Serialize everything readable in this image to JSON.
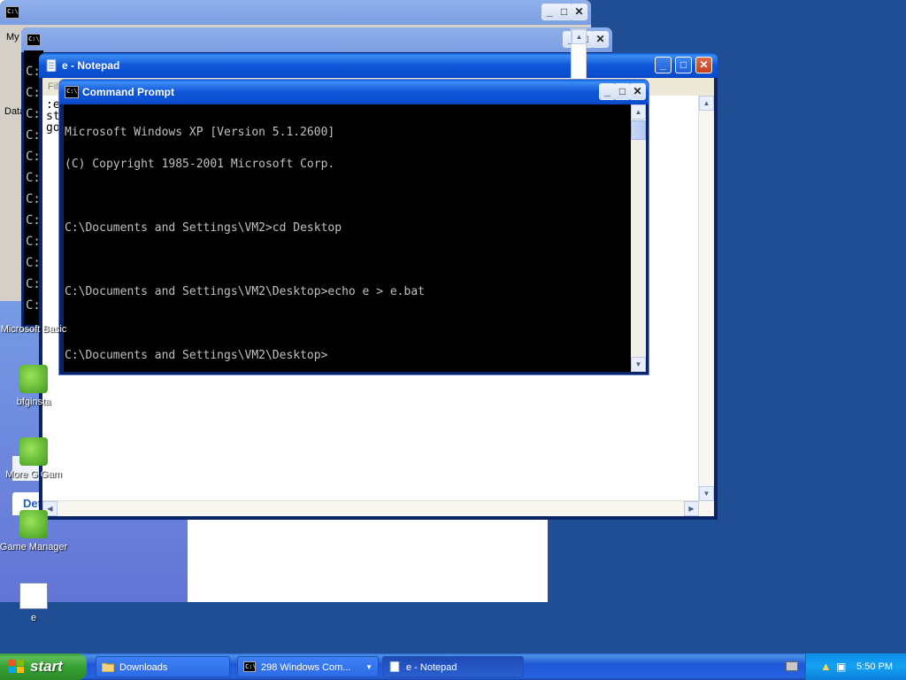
{
  "windows": {
    "back1": {
      "title": "",
      "side_text": [
        "My",
        "Data"
      ]
    },
    "back2": {
      "title": "",
      "prompts": [
        "C:",
        "C:",
        "C:",
        "C:",
        "C:",
        "C:",
        "C:",
        "C:",
        "C:",
        "C:",
        "C:",
        "C:"
      ]
    },
    "notepad": {
      "title": "e - Notepad",
      "menu_fragment": "File",
      "lines": [
        ":e",
        "st",
        "go"
      ]
    },
    "cmd": {
      "title": "Command Prompt",
      "lines": [
        "Microsoft Windows XP [Version 5.1.2600]",
        "(C) Copyright 1985-2001 Microsoft Corp.",
        "",
        "C:\\Documents and Settings\\VM2>cd Desktop",
        "",
        "C:\\Documents and Settings\\VM2\\Desktop>echo e > e.bat",
        "",
        "C:\\Documents and Settings\\VM2\\Desktop>"
      ]
    }
  },
  "explorer": {
    "details_label": "Details"
  },
  "desktop_icons": [
    {
      "label": "Microsoft Basic",
      "icon": "app-icon"
    },
    {
      "label": "bfginsta",
      "icon": "bfg-installer-icon"
    },
    {
      "label": "More G Gam",
      "icon": "bfg-shortcut-icon"
    },
    {
      "label": "Game Manager",
      "icon": "game-manager-icon"
    },
    {
      "label": "e",
      "icon": "batch-file-icon"
    }
  ],
  "taskbar": {
    "start_label": "start",
    "tasks": [
      {
        "label": "Downloads",
        "icon": "folder-icon"
      },
      {
        "label": "298 Windows Com...",
        "icon": "cmd-icon"
      },
      {
        "label": "e - Notepad",
        "icon": "notepad-icon"
      }
    ],
    "clock": "5:50 PM"
  },
  "colors": {
    "desktop": "#1f4e95",
    "titlebar_active": "#0b4fcf",
    "start_green": "#36a032",
    "console_bg": "#000000",
    "console_fg": "#c0c0c0"
  }
}
